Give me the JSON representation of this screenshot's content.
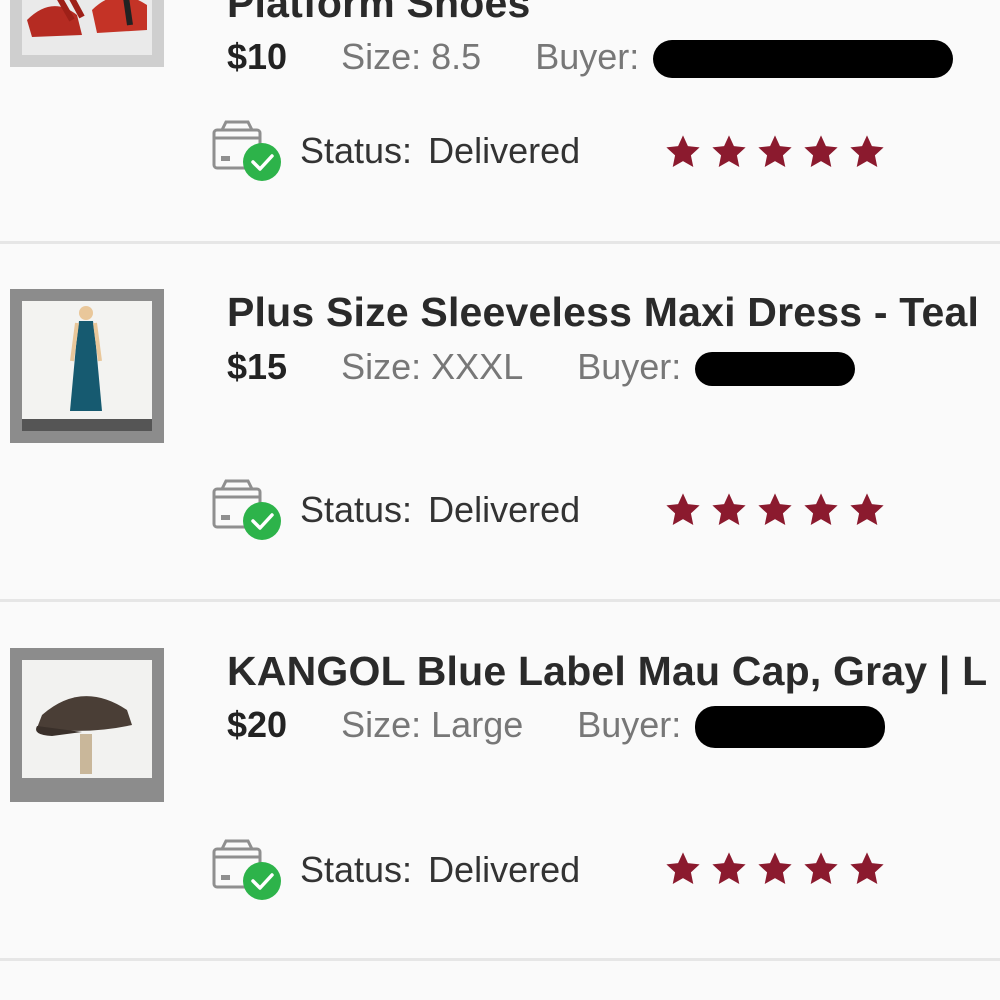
{
  "colors": {
    "star": "#8b1a2e",
    "check_green": "#2db34a",
    "divider": "#e6e6e6",
    "redaction": "#000000"
  },
  "items": [
    {
      "title": "Platform Shoes",
      "price": "$10",
      "size_label": "Size:",
      "size_value": "8.5",
      "buyer_label": "Buyer:",
      "status_label": "Status:",
      "status_value": "Delivered",
      "rating": 5,
      "thumbnail_icon": "red-heels-photo"
    },
    {
      "title": "Plus Size Sleeveless Maxi Dress - Teal",
      "price": "$15",
      "size_label": "Size:",
      "size_value": "XXXL",
      "buyer_label": "Buyer:",
      "status_label": "Status:",
      "status_value": "Delivered",
      "rating": 5,
      "thumbnail_icon": "teal-dress-photo"
    },
    {
      "title": "KANGOL Blue Label Mau Cap, Gray | L",
      "price": "$20",
      "size_label": "Size:",
      "size_value": "Large",
      "buyer_label": "Buyer:",
      "status_label": "Status:",
      "status_value": "Delivered",
      "rating": 5,
      "thumbnail_icon": "gray-cap-photo"
    }
  ]
}
